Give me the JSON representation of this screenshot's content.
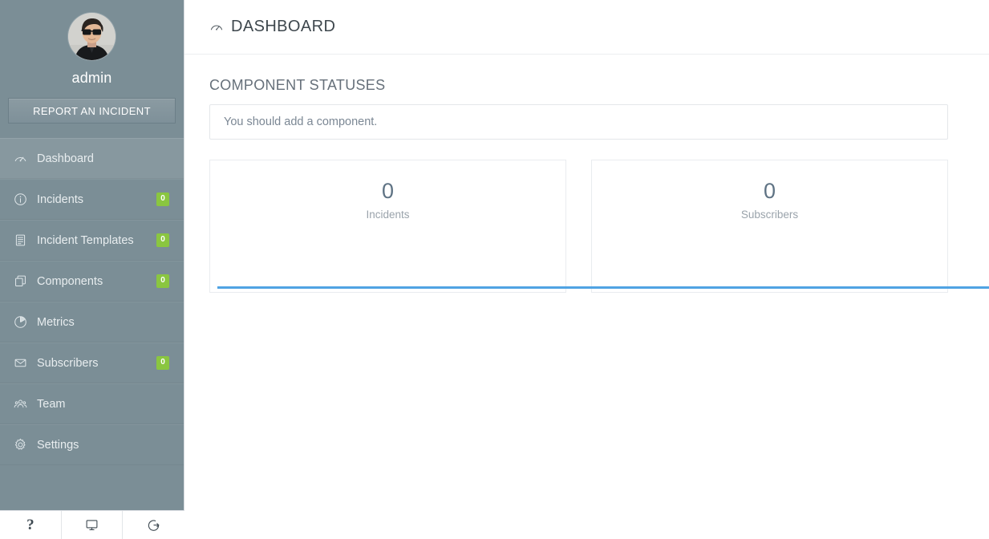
{
  "sidebar": {
    "profile": {
      "name": "admin",
      "avatar_icon": "user-avatar-photo"
    },
    "report_button": {
      "label": "REPORT AN INCIDENT"
    },
    "nav_items": [
      {
        "label": "Dashboard",
        "icon": "gauge-icon",
        "badge": null,
        "active": true
      },
      {
        "label": "Incidents",
        "icon": "info-circle-icon",
        "badge": "0",
        "active": false
      },
      {
        "label": "Incident Templates",
        "icon": "document-list-icon",
        "badge": "0",
        "active": false
      },
      {
        "label": "Components",
        "icon": "layers-copy-icon",
        "badge": "0",
        "active": false
      },
      {
        "label": "Metrics",
        "icon": "pie-chart-icon",
        "badge": null,
        "active": false
      },
      {
        "label": "Subscribers",
        "icon": "envelope-icon",
        "badge": "0",
        "active": false
      },
      {
        "label": "Team",
        "icon": "people-group-icon",
        "badge": null,
        "active": false
      },
      {
        "label": "Settings",
        "icon": "gear-icon",
        "badge": null,
        "active": false
      }
    ],
    "footer_buttons": [
      {
        "icon": "question-mark-icon",
        "label": "?"
      },
      {
        "icon": "monitor-screen-icon",
        "label": ""
      },
      {
        "icon": "sign-out-icon",
        "label": ""
      }
    ]
  },
  "header": {
    "title": "DASHBOARD",
    "icon": "gauge-icon"
  },
  "main": {
    "section_title": "COMPONENT STATUSES",
    "empty_message": "You should add a component.",
    "stats": [
      {
        "value": "0",
        "label": "Incidents"
      },
      {
        "value": "0",
        "label": "Subscribers"
      }
    ]
  },
  "colors": {
    "sidebar_bg": "#7b8e96",
    "sidebar_active_bg": "#87989f",
    "badge_green": "#8ac640",
    "accent_blue": "#4fa3e3",
    "title_gray": "#3e474d"
  }
}
